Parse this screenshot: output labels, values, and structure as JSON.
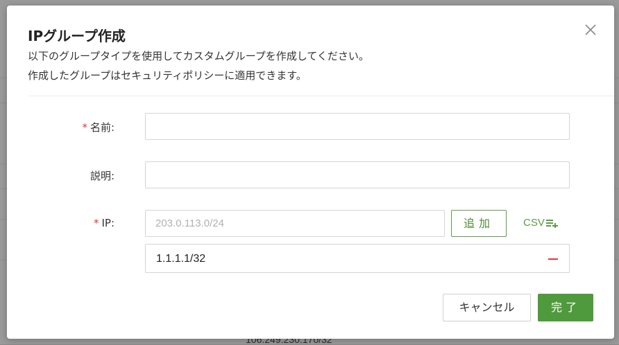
{
  "background": {
    "visible_text": "106.249.230.170/32"
  },
  "dialog": {
    "title": "IPグループ作成",
    "description_line1": "以下のグループタイプを使用してカスタムグループを作成してください。",
    "description_line2": "作成したグループはセキュリティポリシーに適用できます。",
    "close_icon": "close-icon"
  },
  "form": {
    "name": {
      "required_mark": "*",
      "label": "名前:",
      "value": ""
    },
    "description": {
      "label": "説明:",
      "value": ""
    },
    "ip": {
      "required_mark": "*",
      "label": "IP:",
      "placeholder": "203.0.113.0/24",
      "add_button": "追加",
      "csv_link": "CSV",
      "csv_icon": "list-add-icon",
      "entries": [
        "1.1.1.1/32"
      ],
      "remove_icon": "minus-icon"
    }
  },
  "footer": {
    "cancel_button": "キャンセル",
    "done_button": "完了"
  },
  "colors": {
    "accent": "#4f9a3c",
    "required": "#e0363a"
  }
}
